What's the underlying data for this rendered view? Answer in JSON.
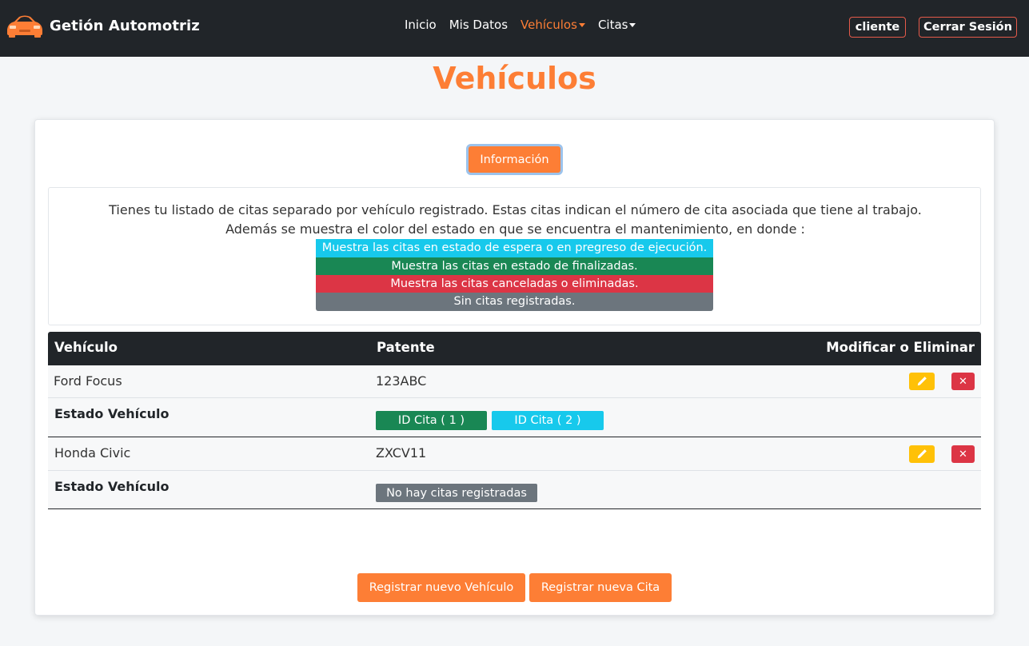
{
  "navbar": {
    "brand": "Getión Automotriz",
    "links": [
      {
        "label": "Inicio"
      },
      {
        "label": "Mis Datos"
      },
      {
        "label": "Vehículos"
      },
      {
        "label": "Citas"
      }
    ],
    "user_label": "cliente",
    "logout_label": "Cerrar Sesión"
  },
  "page": {
    "title": "Vehículos"
  },
  "info": {
    "button_label": "Información",
    "line1": "Tienes tu listado de citas separado por vehículo registrado. Estas citas indican el número de cita asociada que tiene al trabajo.",
    "line2": "Además se muestra el color del estado en que se encuentra el mantenimiento, en donde :",
    "legend": [
      {
        "text": "Muestra las citas en estado de espera o en pregreso de ejecución.",
        "color": "#17c9ec"
      },
      {
        "text": "Muestra las citas en estado de finalizadas.",
        "color": "#198754"
      },
      {
        "text": "Muestra las citas canceladas o eliminadas.",
        "color": "#dc3545"
      },
      {
        "text": "Sin citas registradas.",
        "color": "#6c757d"
      }
    ]
  },
  "table": {
    "headers": [
      "Vehículo",
      "Patente",
      "Modificar o Eliminar"
    ],
    "status_label": "Estado Vehículo",
    "rows": [
      {
        "vehicle": "Ford Focus",
        "plate": "123ABC",
        "badges": [
          {
            "label": "ID Cita ( 1 )",
            "color": "#198754"
          },
          {
            "label": "ID Cita ( 2 )",
            "color": "#17c9ec"
          }
        ]
      },
      {
        "vehicle": "Honda Civic",
        "plate": "ZXCV11",
        "badges": [
          {
            "label": "No hay citas registradas",
            "color": "#6c757d"
          }
        ]
      }
    ]
  },
  "actions": {
    "register_vehicle": "Registrar nuevo Vehículo",
    "register_appointment": "Registrar nueva Cita"
  },
  "colors": {
    "accent": "#fd7e35",
    "navbar_bg": "#212529",
    "edit": "#ffc107",
    "delete": "#dc3545"
  }
}
